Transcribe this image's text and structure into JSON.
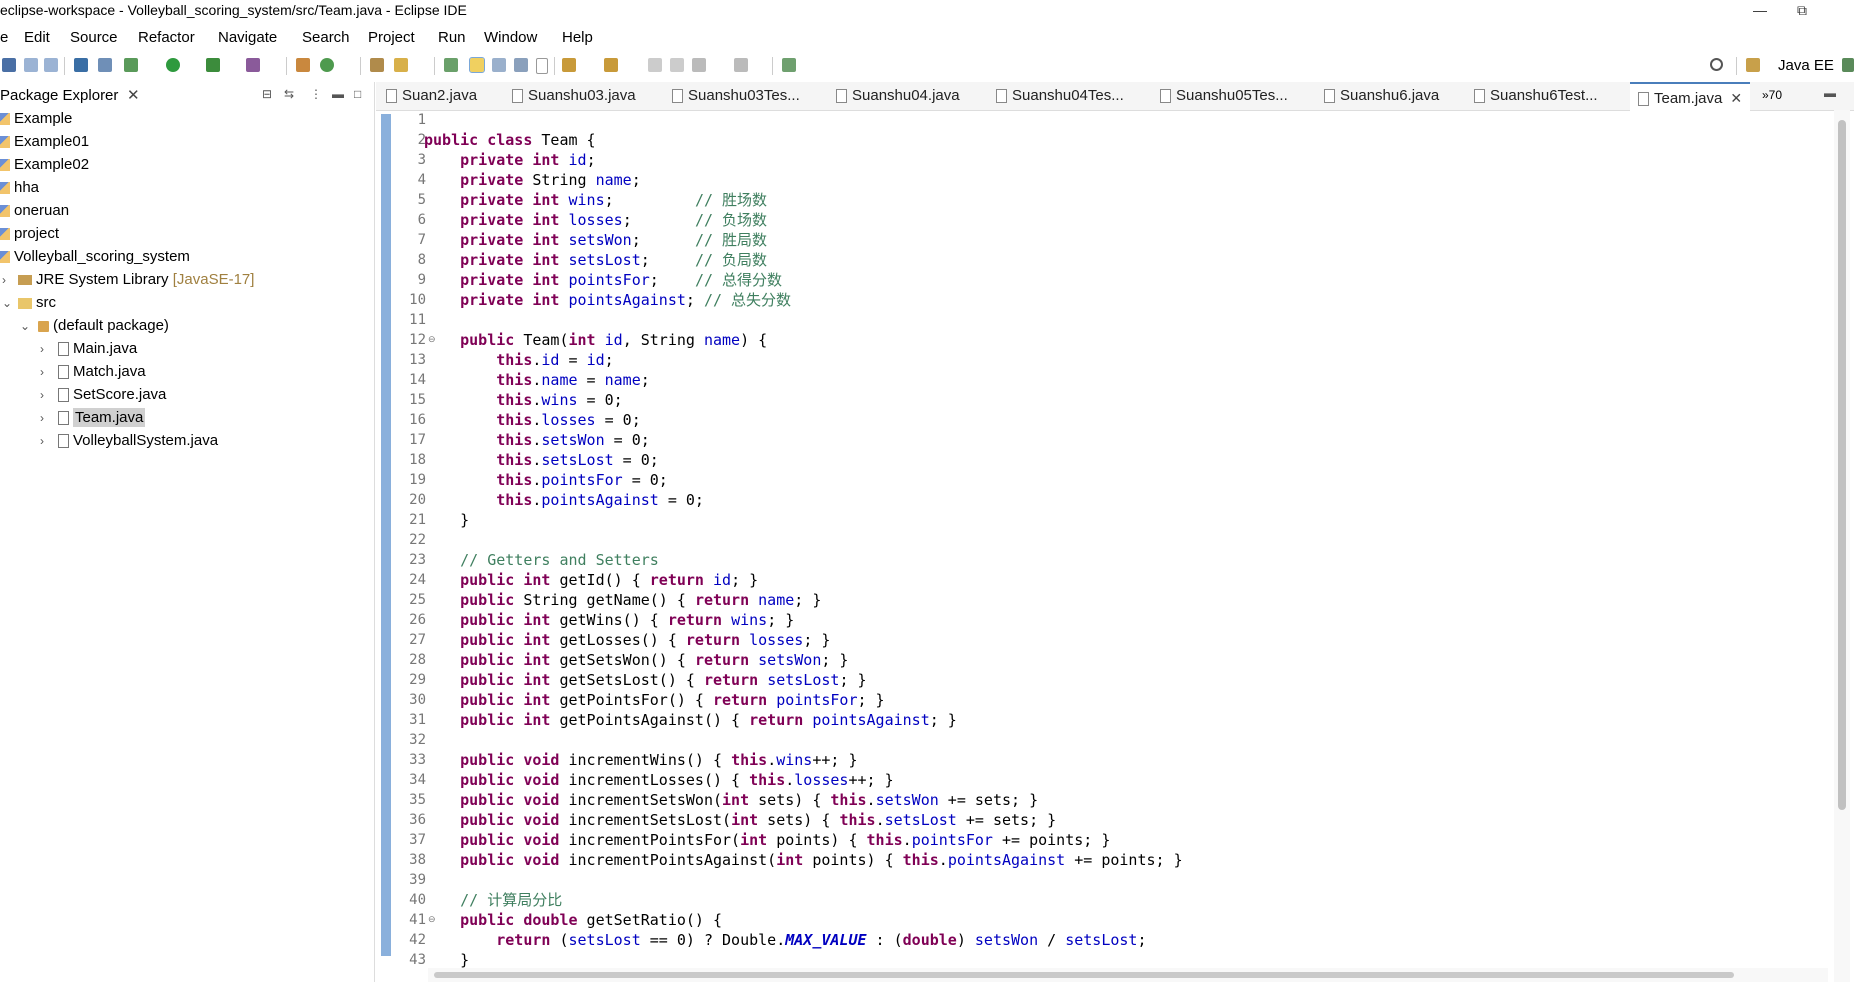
{
  "window": {
    "title": "eclipse-workspace - Volleyball_scoring_system/src/Team.java - Eclipse IDE",
    "minimize": "—",
    "restore": "⧉"
  },
  "menu": [
    "e",
    "Edit",
    "Source",
    "Refactor",
    "Navigate",
    "Search",
    "Project",
    "Run",
    "Window",
    "Help"
  ],
  "perspective": "Java EE",
  "package_explorer": {
    "title": "Package Explorer",
    "items": [
      {
        "label": "Example"
      },
      {
        "label": "Example01"
      },
      {
        "label": "Example02"
      },
      {
        "label": "hha"
      },
      {
        "label": "oneruan"
      },
      {
        "label": "project"
      },
      {
        "label": "Volleyball_scoring_system"
      },
      {
        "label": "JRE System Library",
        "extra": "[JavaSE-17]"
      },
      {
        "label": "src"
      },
      {
        "label": "(default package)"
      },
      {
        "label": "Main.java"
      },
      {
        "label": "Match.java"
      },
      {
        "label": "SetScore.java"
      },
      {
        "label": "Team.java"
      },
      {
        "label": "VolleyballSystem.java"
      }
    ]
  },
  "tabs": [
    {
      "label": "Suan2.java"
    },
    {
      "label": "Suanshu03.java"
    },
    {
      "label": "Suanshu03Tes..."
    },
    {
      "label": "Suanshu04.java"
    },
    {
      "label": "Suanshu04Tes..."
    },
    {
      "label": "Suanshu05Tes..."
    },
    {
      "label": "Suanshu6.java"
    },
    {
      "label": "Suanshu6Test..."
    },
    {
      "label": "Team.java",
      "close": "✕"
    }
  ],
  "overflow_tabs": "»70",
  "code_lines": [
    "",
    "public class Team {",
    "    private int id;",
    "    private String name;",
    "    private int wins;         // 胜场数",
    "    private int losses;       // 负场数",
    "    private int setsWon;      // 胜局数",
    "    private int setsLost;     // 负局数",
    "    private int pointsFor;    // 总得分数",
    "    private int pointsAgainst; // 总失分数",
    "",
    "    public Team(int id, String name) {",
    "        this.id = id;",
    "        this.name = name;",
    "        this.wins = 0;",
    "        this.losses = 0;",
    "        this.setsWon = 0;",
    "        this.setsLost = 0;",
    "        this.pointsFor = 0;",
    "        this.pointsAgainst = 0;",
    "    }",
    "",
    "    // Getters and Setters",
    "    public int getId() { return id; }",
    "    public String getName() { return name; }",
    "    public int getWins() { return wins; }",
    "    public int getLosses() { return losses; }",
    "    public int getSetsWon() { return setsWon; }",
    "    public int getSetsLost() { return setsLost; }",
    "    public int getPointsFor() { return pointsFor; }",
    "    public int getPointsAgainst() { return pointsAgainst; }",
    "",
    "    public void incrementWins() { this.wins++; }",
    "    public void incrementLosses() { this.losses++; }",
    "    public void incrementSetsWon(int sets) { this.setsWon += sets; }",
    "    public void incrementSetsLost(int sets) { this.setsLost += sets; }",
    "    public void incrementPointsFor(int points) { this.pointsFor += points; }",
    "    public void incrementPointsAgainst(int points) { this.pointsAgainst += points; }",
    "",
    "    // 计算局分比",
    "    public double getSetRatio() {",
    "        return (setsLost == 0) ? Double.MAX_VALUE : (double) setsWon / setsLost;",
    "    }"
  ],
  "colors": {
    "keyword": "#7f0055",
    "field": "#0000c0",
    "comment": "#3f7f5f",
    "selection": "#d0d0d0",
    "gutter_marker": "#8ab0dc"
  }
}
